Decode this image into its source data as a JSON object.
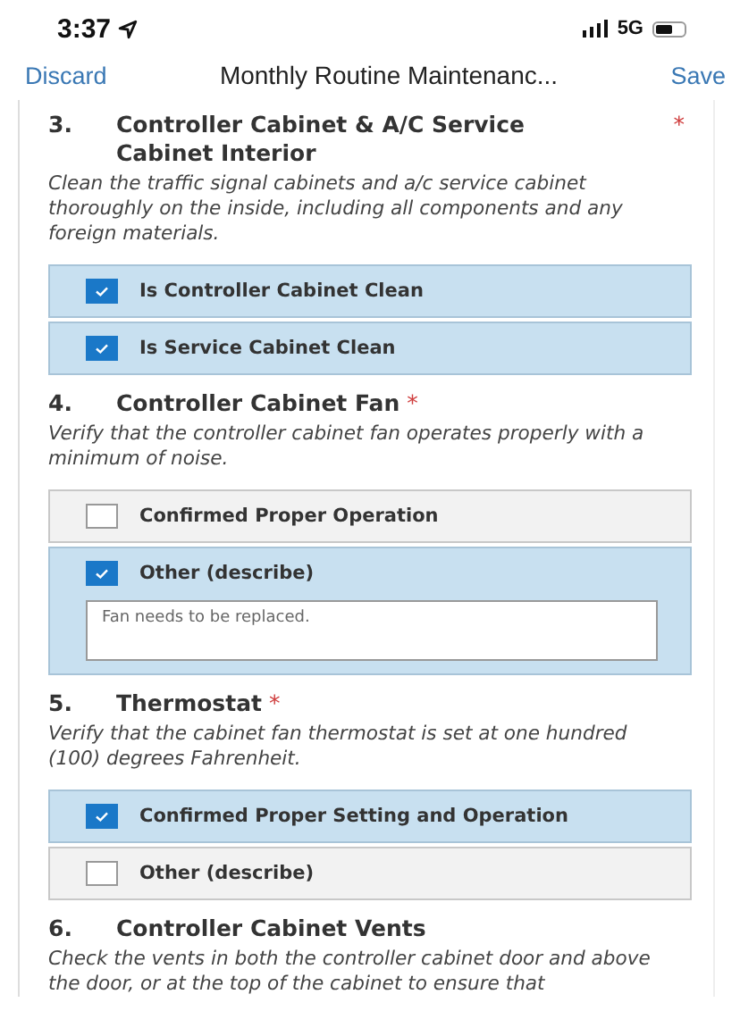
{
  "status_bar": {
    "time": "3:37",
    "network": "5G"
  },
  "nav": {
    "discard": "Discard",
    "title": "Monthly Routine Maintenanc...",
    "save": "Save"
  },
  "questions": [
    {
      "number": "3.",
      "title": "Controller Cabinet & A/C Service Cabinet Interior",
      "required_mark": "*",
      "description": "Clean the traffic signal cabinets and a/c service cabinet thoroughly on the inside, including all components and any foreign materials.",
      "options": [
        {
          "label": "Is Controller Cabinet Clean",
          "checked": true
        },
        {
          "label": "Is Service Cabinet Clean",
          "checked": true
        }
      ]
    },
    {
      "number": "4.",
      "title": "Controller Cabinet Fan",
      "required_mark": "*",
      "description": "Verify that the controller cabinet fan operates properly with a minimum of noise.",
      "options": [
        {
          "label": "Confirmed Proper Operation",
          "checked": false
        },
        {
          "label": "Other (describe)",
          "checked": true,
          "value": "Fan needs to be replaced."
        }
      ]
    },
    {
      "number": "5.",
      "title": "Thermostat",
      "required_mark": "*",
      "description": "Verify that the cabinet fan thermostat is set at one hundred (100) degrees Fahrenheit.",
      "options": [
        {
          "label": "Confirmed Proper Setting and Operation",
          "checked": true
        },
        {
          "label": "Other (describe)",
          "checked": false
        }
      ]
    },
    {
      "number": "6.",
      "title": "Controller Cabinet Vents",
      "description": "Check the vents in both the controller cabinet door and above the door, or at the top of the cabinet to ensure that"
    }
  ]
}
